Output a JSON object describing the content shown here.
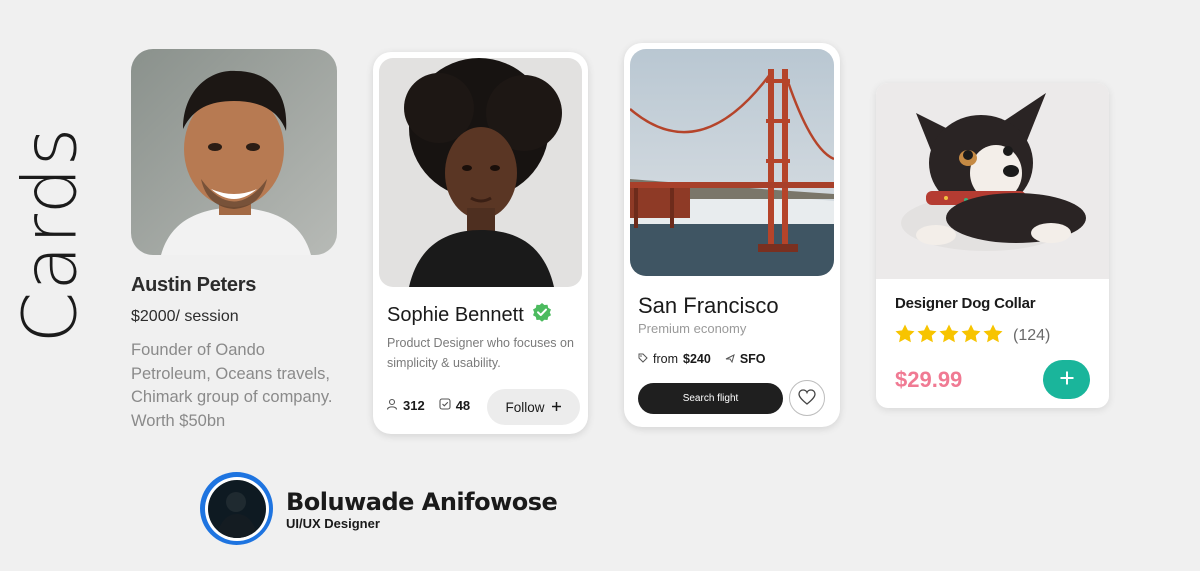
{
  "page": {
    "title": "Cards"
  },
  "profile_card": {
    "name": "Austin Peters",
    "price": "$2000/ session",
    "bio": "Founder of Oando Petroleum, Oceans travels, Chimark group of company. Worth $50bn"
  },
  "designer_card": {
    "name": "Sophie Bennett",
    "bio": "Product Designer who focuses on simplicity & usability.",
    "followers": "312",
    "projects": "48",
    "follow_label": "Follow"
  },
  "travel_card": {
    "city": "San Francisco",
    "subtitle": "Premium economy",
    "price_prefix": "from",
    "price": "$240",
    "airport": "SFO",
    "search_label": "Search flight"
  },
  "product_card": {
    "title": "Designer Dog Collar",
    "rating": 5,
    "review_count": "(124)",
    "price": "$29.99"
  },
  "author": {
    "name": "Boluwade Anifowose",
    "role": "UI/UX Designer"
  },
  "colors": {
    "verified": "#4cbb5f",
    "star": "#f7c400",
    "price_pink": "#f07a93",
    "add_button": "#1ab59b",
    "avatar_ring": "#1e74e0"
  }
}
